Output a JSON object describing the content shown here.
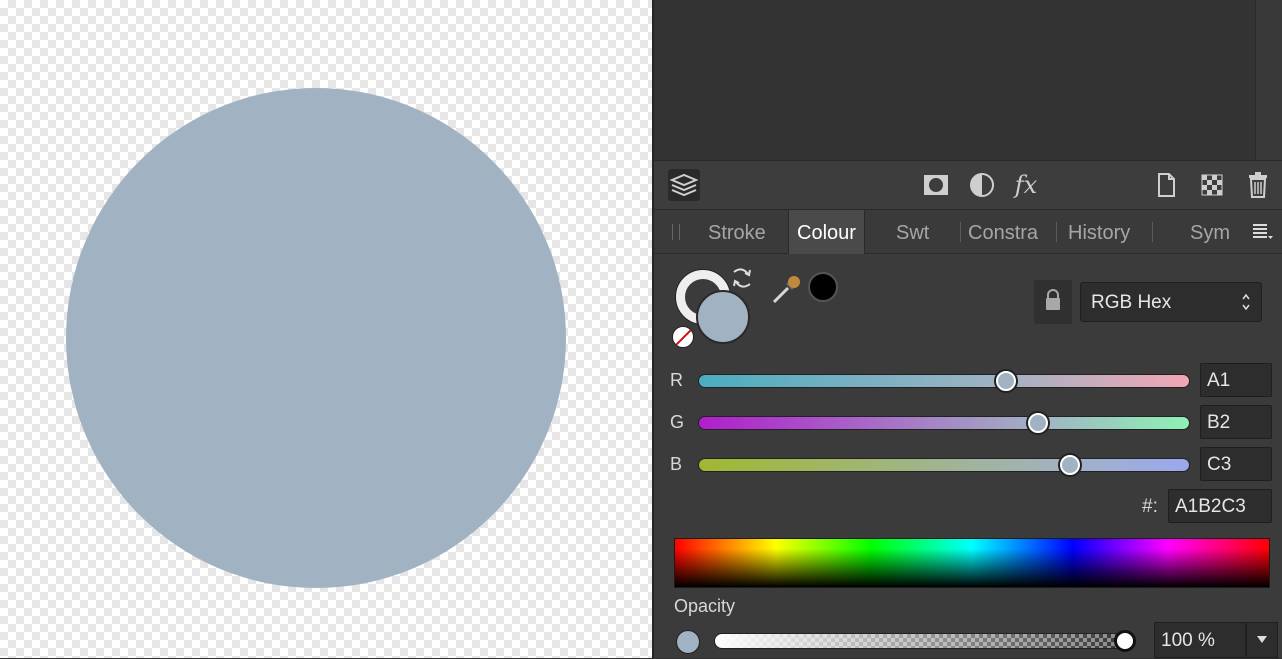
{
  "colors": {
    "fill": "#A1B2C3",
    "knob": "#A1B2C3"
  },
  "tabs": [
    "Stroke",
    "Colour",
    "Swt",
    "Constra",
    "History",
    "Sym"
  ],
  "active_tab": "Colour",
  "colour": {
    "model": "RGB Hex",
    "channels": [
      {
        "label": "R",
        "value": "A1",
        "position": 0.625
      },
      {
        "label": "G",
        "value": "B2",
        "position": 0.69
      },
      {
        "label": "B",
        "value": "C3",
        "position": 0.75
      }
    ],
    "hex_label": "#:",
    "hex_value": "A1B2C3",
    "opacity_label": "Opacity",
    "opacity_value": "100 %"
  },
  "toolbar": {
    "icons": [
      "layers-icon",
      "mask-icon",
      "adjustment-icon",
      "fx-icon",
      "new-document-icon",
      "checker-icon",
      "trash-icon"
    ]
  }
}
